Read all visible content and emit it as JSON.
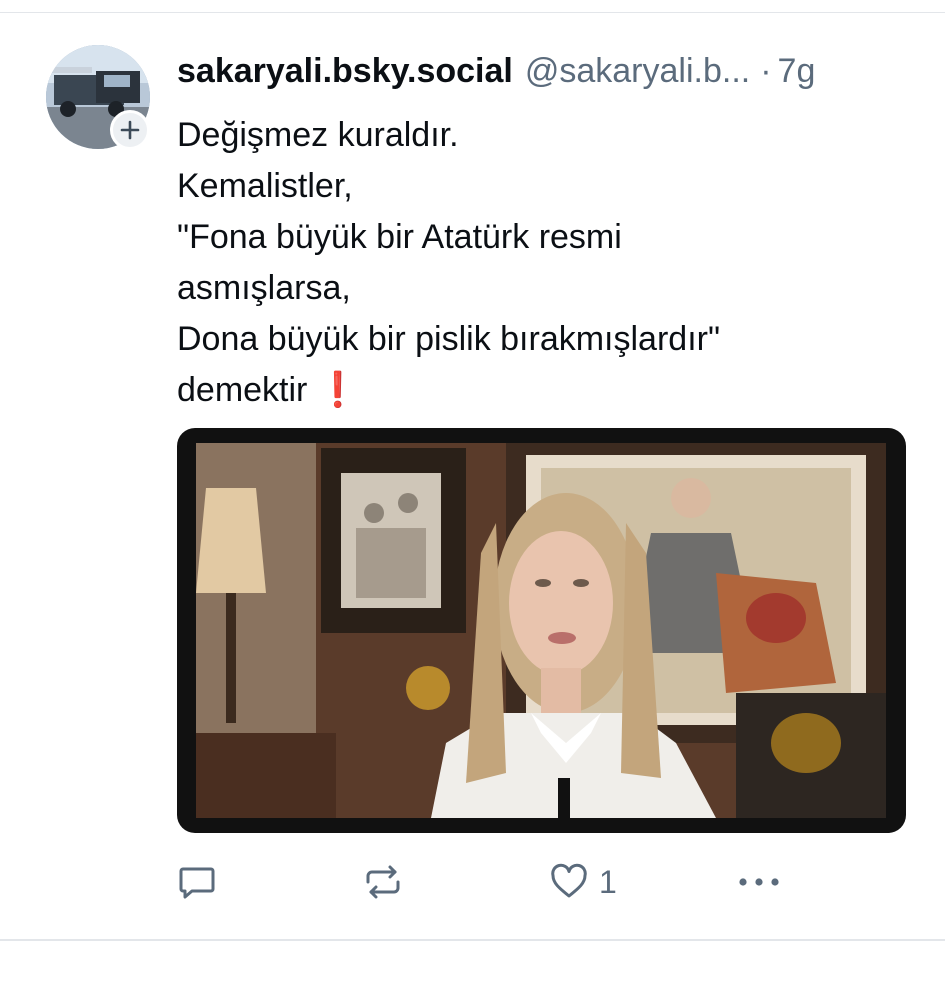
{
  "post": {
    "author": {
      "display_name": "sakaryali.bsky.social",
      "handle": "@sakaryali.b...",
      "avatar": "profile-photo-truck"
    },
    "time_separator": "·",
    "time": "7g",
    "text_lines": [
      "Değişmez kuraldır.",
      "Kemalistler,",
      "\"Fona büyük bir Atatürk resmi",
      "asmışlarsa,",
      "Dona büyük bir pislik bırakmışlardır\"",
      "demektir"
    ],
    "text_trailing_emoji": "❗",
    "media": {
      "type": "video-still",
      "description_icon": "woman-speaking-in-front-of-ataturk-portrait"
    },
    "actions": {
      "reply_icon": "speech-bubble-icon",
      "repost_icon": "repost-icon",
      "like_icon": "heart-icon",
      "like_count": "1",
      "more_icon": "ellipsis-icon"
    }
  },
  "colors": {
    "text_primary": "#0b0f14",
    "text_secondary": "#5b6b7c",
    "accent_red": "#e0211b",
    "divider": "#e3e6ea"
  }
}
